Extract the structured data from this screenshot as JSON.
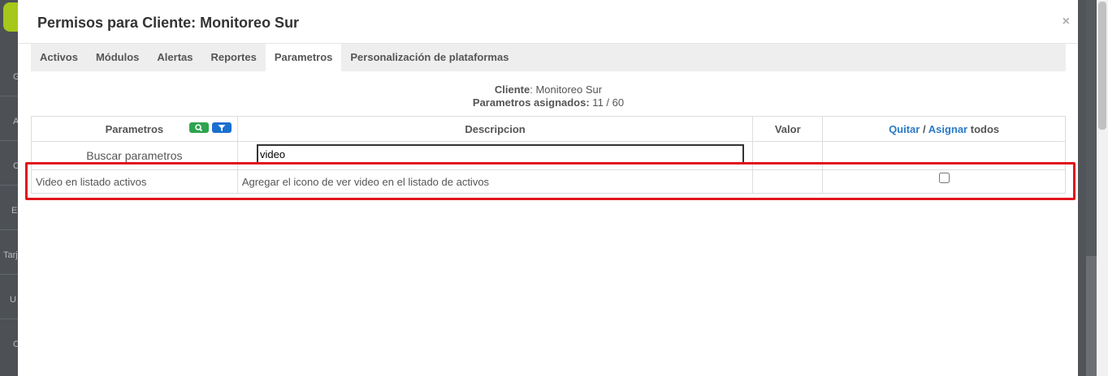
{
  "sidebar": {
    "letters": [
      "G",
      "A",
      "C",
      "E",
      "Tarj",
      "U",
      "C"
    ]
  },
  "modal": {
    "title": "Permisos para Cliente: Monitoreo Sur",
    "close": "×"
  },
  "tabs": [
    {
      "label": "Activos"
    },
    {
      "label": "Módulos"
    },
    {
      "label": "Alertas"
    },
    {
      "label": "Reportes"
    },
    {
      "label": "Parametros",
      "active": true
    },
    {
      "label": "Personalización de plataformas"
    }
  ],
  "info": {
    "client_label": "Cliente",
    "client_value": ": Monitoreo Sur",
    "assigned_label": "Parametros asignados:",
    "assigned_value": " 11 / 60"
  },
  "table": {
    "headers": {
      "parametros": "Parametros",
      "descripcion": "Descripcion",
      "valor": "Valor",
      "quitar": "Quitar",
      "slash": " / ",
      "asignar": "Asignar",
      "todos": " todos"
    },
    "search_label": "Buscar parametros",
    "search_value": "video",
    "rows": [
      {
        "name": "Video en listado activos",
        "description": "Agregar el icono de ver video en el listado de activos",
        "value": "",
        "checked": false
      }
    ]
  },
  "colors": {
    "highlight": "#e0131b",
    "link": "#2a7ac8",
    "search_button": "#2ea44f",
    "filter_button": "#1a6fcf"
  }
}
